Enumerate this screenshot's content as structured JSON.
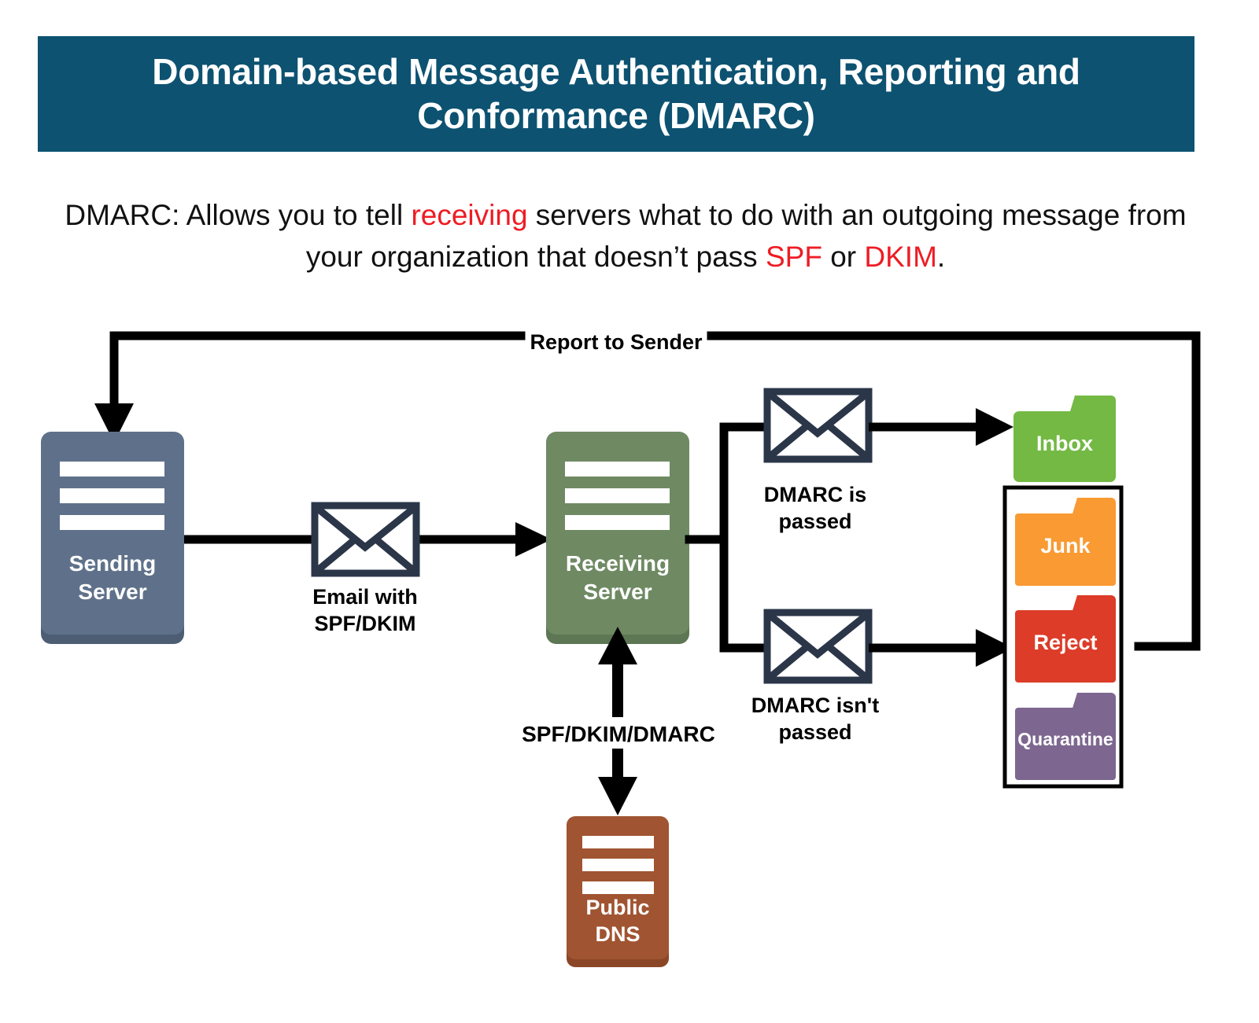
{
  "banner": {
    "title": "Domain-based Message Authentication, Reporting and Conformance (DMARC)",
    "background_color": "#0d5271",
    "text_color": "#ffffff"
  },
  "intro": {
    "line1_part1": "DMARC: Allows you to tell ",
    "line1_highlight": "receiving",
    "line1_part2": " servers what to do with an outgoing message from",
    "line2_part1": "your organization that doesn’t pass ",
    "line2_highlight1": "SPF",
    "line2_mid": " or ",
    "line2_highlight2": "DKIM",
    "line2_end": ".",
    "highlight_color": "#ee1c24"
  },
  "diagram": {
    "nodes": {
      "sending_server": {
        "label_line1": "Sending",
        "label_line2": "Server",
        "color": "#5f718a",
        "shadow_color": "#4d5e74"
      },
      "receiving_server": {
        "label_line1": "Receiving",
        "label_line2": "Server",
        "color": "#6f8a63",
        "shadow_color": "#5d7653"
      },
      "public_dns": {
        "label_line1": "Public",
        "label_line2": "DNS",
        "color": "#a05431",
        "shadow_color": "#8b4627"
      }
    },
    "envelopes": {
      "email_spf_dkim": {
        "label_line1": "Email with",
        "label_line2": "SPF/DKIM",
        "stroke_color": "#2b3649"
      },
      "dmarc_passed": {
        "label_line1": "DMARC is",
        "label_line2": "passed",
        "stroke_color": "#2b3649"
      },
      "dmarc_not_passed": {
        "label_line1": "DMARC isn't",
        "label_line2": "passed",
        "stroke_color": "#2b3649"
      }
    },
    "connector_labels": {
      "report_to_sender": "Report to Sender",
      "spf_dkim_dmarc": "SPF/DKIM/DMARC"
    },
    "folders": [
      {
        "label": "Inbox",
        "color": "#73b944",
        "tab_color": "#73b944"
      },
      {
        "label": "Junk",
        "color": "#f99a33",
        "tab_color": "#f99a33"
      },
      {
        "label": "Reject",
        "color": "#dc3c28",
        "tab_color": "#dc3c28"
      },
      {
        "label": "Quarantine",
        "color": "#7d6790",
        "tab_color": "#7d6790"
      }
    ],
    "line_color": "#000000"
  }
}
